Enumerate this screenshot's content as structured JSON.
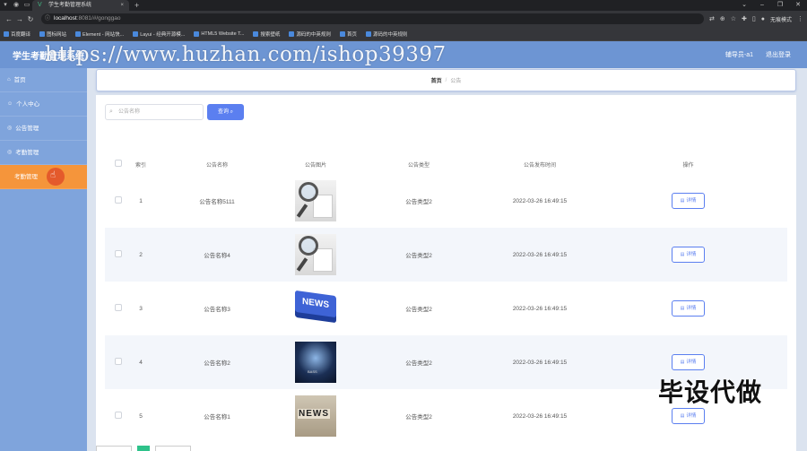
{
  "browser": {
    "tab_title": "学生考勤管理系统",
    "url_host": "localhost",
    "url_path": ":8081/#/gonggao",
    "profile_label": "无痕模式",
    "bookmarks": [
      "百度翻译",
      "图标网站",
      "Element - 网站快...",
      "Layui - 经典开源模...",
      "HTML5 Website T...",
      "搜索壁纸",
      "源码的中英规则",
      "首页",
      "源码的中英规则"
    ]
  },
  "header": {
    "app_title": "学生考勤管理系统",
    "watermark": "https://www.huzhan.com/ishop39397",
    "user_label": "辅导员-a1",
    "logout_label": "退出登录"
  },
  "sidebar": {
    "items": [
      {
        "label": "首页",
        "icon": "home-icon"
      },
      {
        "label": "个人中心",
        "icon": "user-icon"
      },
      {
        "label": "公告管理",
        "icon": "notice-icon"
      },
      {
        "label": "考勤管理",
        "icon": "attendance-icon"
      },
      {
        "label": "考勤管理",
        "icon": "attendance-icon"
      }
    ]
  },
  "breadcrumb": {
    "home": "首页",
    "separator": "/",
    "current": "公告"
  },
  "search": {
    "placeholder": "公告名称",
    "button_label": "查询"
  },
  "table": {
    "headers": [
      "索引",
      "公告名称",
      "公告图片",
      "公告类型",
      "公告发布时间",
      "操作"
    ],
    "rows": [
      {
        "index": "1",
        "name": "公告名称5111",
        "image": "magnifier",
        "type": "公告类型2",
        "time": "2022-03-26 16:49:15",
        "action": "详情"
      },
      {
        "index": "2",
        "name": "公告名称4",
        "image": "magnifier",
        "type": "公告类型2",
        "time": "2022-03-26 16:49:15",
        "action": "详情"
      },
      {
        "index": "3",
        "name": "公告名称3",
        "image": "news-3d",
        "type": "公告类型2",
        "time": "2022-03-26 16:49:15",
        "action": "详情"
      },
      {
        "index": "4",
        "name": "公告名称2",
        "image": "stage",
        "type": "公告类型2",
        "time": "2022-03-26 16:49:15",
        "action": "详情"
      },
      {
        "index": "5",
        "name": "公告名称1",
        "image": "news-tiles",
        "type": "公告类型2",
        "time": "2022-03-26 16:49:15",
        "action": "详情"
      }
    ]
  },
  "overlay_text": "毕设代做",
  "image_text": {
    "news_key": "NEWS",
    "news_tiles": "NEWS",
    "stage_label": "BASS"
  },
  "colors": {
    "header_bg": "#6d95d3",
    "sidebar_bg": "#7fa4dc",
    "active_item": "#f5953b",
    "primary": "#5b7ff0"
  }
}
